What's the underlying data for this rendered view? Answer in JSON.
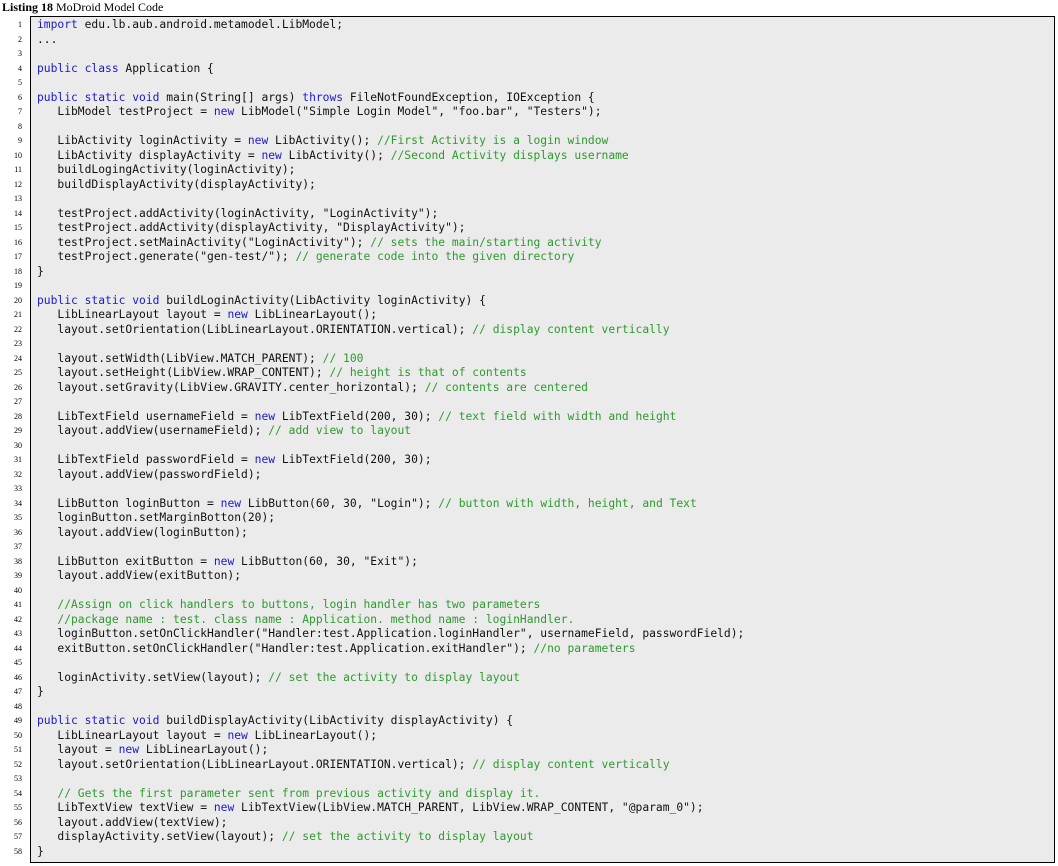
{
  "caption": {
    "label": "Listing 18",
    "title": "MoDroid Model Code"
  },
  "colors": {
    "keyword": "#1a1acc",
    "comment": "#2e9a2e",
    "text": "#111111",
    "background": "#ebebeb"
  },
  "lines": [
    {
      "n": "1",
      "tokens": [
        [
          "kw",
          "import"
        ],
        [
          "tx",
          " edu.lb.aub.android.metamodel.LibModel;"
        ]
      ]
    },
    {
      "n": "2",
      "tokens": [
        [
          "tx",
          "..."
        ]
      ]
    },
    {
      "n": "3",
      "tokens": []
    },
    {
      "n": "4",
      "tokens": [
        [
          "kw",
          "public class"
        ],
        [
          "tx",
          " Application {"
        ]
      ]
    },
    {
      "n": "5",
      "tokens": []
    },
    {
      "n": "6",
      "tokens": [
        [
          "kw",
          "public static void"
        ],
        [
          "tx",
          " main(String[] args) "
        ],
        [
          "kw",
          "throws"
        ],
        [
          "tx",
          " FileNotFoundException, IOException {"
        ]
      ]
    },
    {
      "n": "7",
      "tokens": [
        [
          "tx",
          "   LibModel testProject = "
        ],
        [
          "kw",
          "new"
        ],
        [
          "tx",
          " LibModel(\"Simple Login Model\", \"foo.bar\", \"Testers\");"
        ]
      ]
    },
    {
      "n": "8",
      "tokens": []
    },
    {
      "n": "9",
      "tokens": [
        [
          "tx",
          "   LibActivity loginActivity = "
        ],
        [
          "kw",
          "new"
        ],
        [
          "tx",
          " LibActivity(); "
        ],
        [
          "cm",
          "//First Activity is a login window"
        ]
      ]
    },
    {
      "n": "10",
      "tokens": [
        [
          "tx",
          "   LibActivity displayActivity = "
        ],
        [
          "kw",
          "new"
        ],
        [
          "tx",
          " LibActivity(); "
        ],
        [
          "cm",
          "//Second Activity displays username"
        ]
      ]
    },
    {
      "n": "11",
      "tokens": [
        [
          "tx",
          "   buildLogingActivity(loginActivity);"
        ]
      ]
    },
    {
      "n": "12",
      "tokens": [
        [
          "tx",
          "   buildDisplayActivity(displayActivity);"
        ]
      ]
    },
    {
      "n": "13",
      "tokens": []
    },
    {
      "n": "14",
      "tokens": [
        [
          "tx",
          "   testProject.addActivity(loginActivity, \"LoginActivity\");"
        ]
      ]
    },
    {
      "n": "15",
      "tokens": [
        [
          "tx",
          "   testProject.addActivity(displayActivity, \"DisplayActivity\");"
        ]
      ]
    },
    {
      "n": "16",
      "tokens": [
        [
          "tx",
          "   testProject.setMainActivity(\"LoginActivity\"); "
        ],
        [
          "cm",
          "// sets the main/starting activity"
        ]
      ]
    },
    {
      "n": "17",
      "tokens": [
        [
          "tx",
          "   testProject.generate(\"gen-test/\"); "
        ],
        [
          "cm",
          "// generate code into the given directory"
        ]
      ]
    },
    {
      "n": "18",
      "tokens": [
        [
          "tx",
          "}"
        ]
      ]
    },
    {
      "n": "19",
      "tokens": []
    },
    {
      "n": "20",
      "tokens": [
        [
          "kw",
          "public static void"
        ],
        [
          "tx",
          " buildLoginActivity(LibActivity loginActivity) {"
        ]
      ]
    },
    {
      "n": "21",
      "tokens": [
        [
          "tx",
          "   LibLinearLayout layout = "
        ],
        [
          "kw",
          "new"
        ],
        [
          "tx",
          " LibLinearLayout();"
        ]
      ]
    },
    {
      "n": "22",
      "tokens": [
        [
          "tx",
          "   layout.setOrientation(LibLinearLayout.ORIENTATION.vertical); "
        ],
        [
          "cm",
          "// display content vertically"
        ]
      ]
    },
    {
      "n": "23",
      "tokens": []
    },
    {
      "n": "24",
      "tokens": [
        [
          "tx",
          "   layout.setWidth(LibView.MATCH_PARENT); "
        ],
        [
          "cm",
          "// 100"
        ]
      ]
    },
    {
      "n": "25",
      "tokens": [
        [
          "tx",
          "   layout.setHeight(LibView.WRAP_CONTENT); "
        ],
        [
          "cm",
          "// height is that of contents"
        ]
      ]
    },
    {
      "n": "26",
      "tokens": [
        [
          "tx",
          "   layout.setGravity(LibView.GRAVITY.center_horizontal); "
        ],
        [
          "cm",
          "// contents are centered"
        ]
      ]
    },
    {
      "n": "27",
      "tokens": []
    },
    {
      "n": "28",
      "tokens": [
        [
          "tx",
          "   LibTextField usernameField = "
        ],
        [
          "kw",
          "new"
        ],
        [
          "tx",
          " LibTextField(200, 30); "
        ],
        [
          "cm",
          "// text field with width and height"
        ]
      ]
    },
    {
      "n": "29",
      "tokens": [
        [
          "tx",
          "   layout.addView(usernameField); "
        ],
        [
          "cm",
          "// add view to layout"
        ]
      ]
    },
    {
      "n": "30",
      "tokens": []
    },
    {
      "n": "31",
      "tokens": [
        [
          "tx",
          "   LibTextField passwordField = "
        ],
        [
          "kw",
          "new"
        ],
        [
          "tx",
          " LibTextField(200, 30);"
        ]
      ]
    },
    {
      "n": "32",
      "tokens": [
        [
          "tx",
          "   layout.addView(passwordField);"
        ]
      ]
    },
    {
      "n": "33",
      "tokens": []
    },
    {
      "n": "34",
      "tokens": [
        [
          "tx",
          "   LibButton loginButton = "
        ],
        [
          "kw",
          "new"
        ],
        [
          "tx",
          " LibButton(60, 30, \"Login\"); "
        ],
        [
          "cm",
          "// button with width, height, and Text"
        ]
      ]
    },
    {
      "n": "35",
      "tokens": [
        [
          "tx",
          "   loginButton.setMarginBotton(20);"
        ]
      ]
    },
    {
      "n": "36",
      "tokens": [
        [
          "tx",
          "   layout.addView(loginButton);"
        ]
      ]
    },
    {
      "n": "37",
      "tokens": []
    },
    {
      "n": "38",
      "tokens": [
        [
          "tx",
          "   LibButton exitButton = "
        ],
        [
          "kw",
          "new"
        ],
        [
          "tx",
          " LibButton(60, 30, \"Exit\");"
        ]
      ]
    },
    {
      "n": "39",
      "tokens": [
        [
          "tx",
          "   layout.addView(exitButton);"
        ]
      ]
    },
    {
      "n": "40",
      "tokens": []
    },
    {
      "n": "41",
      "tokens": [
        [
          "cm",
          "   //Assign on click handlers to buttons, login handler has two parameters"
        ]
      ]
    },
    {
      "n": "42",
      "tokens": [
        [
          "cm",
          "   //package name : test. class name : Application. method name : loginHandler."
        ]
      ]
    },
    {
      "n": "43",
      "tokens": [
        [
          "tx",
          "   loginButton.setOnClickHandler(\"Handler:test.Application.loginHandler\", usernameField, passwordField);"
        ]
      ]
    },
    {
      "n": "44",
      "tokens": [
        [
          "tx",
          "   exitButton.setOnClickHandler(\"Handler:test.Application.exitHandler\"); "
        ],
        [
          "cm",
          "//no parameters"
        ]
      ]
    },
    {
      "n": "45",
      "tokens": []
    },
    {
      "n": "46",
      "tokens": [
        [
          "tx",
          "   loginActivity.setView(layout); "
        ],
        [
          "cm",
          "// set the activity to display layout"
        ]
      ]
    },
    {
      "n": "47",
      "tokens": [
        [
          "tx",
          "}"
        ]
      ]
    },
    {
      "n": "48",
      "tokens": []
    },
    {
      "n": "49",
      "tokens": [
        [
          "kw",
          "public static void"
        ],
        [
          "tx",
          " buildDisplayActivity(LibActivity displayActivity) {"
        ]
      ]
    },
    {
      "n": "50",
      "tokens": [
        [
          "tx",
          "   LibLinearLayout layout = "
        ],
        [
          "kw",
          "new"
        ],
        [
          "tx",
          " LibLinearLayout();"
        ]
      ]
    },
    {
      "n": "51",
      "tokens": [
        [
          "tx",
          "   layout = "
        ],
        [
          "kw",
          "new"
        ],
        [
          "tx",
          " LibLinearLayout();"
        ]
      ]
    },
    {
      "n": "52",
      "tokens": [
        [
          "tx",
          "   layout.setOrientation(LibLinearLayout.ORIENTATION.vertical); "
        ],
        [
          "cm",
          "// display content vertically"
        ]
      ]
    },
    {
      "n": "53",
      "tokens": []
    },
    {
      "n": "54",
      "tokens": [
        [
          "cm",
          "   // Gets the first parameter sent from previous activity and display it."
        ]
      ]
    },
    {
      "n": "55",
      "tokens": [
        [
          "tx",
          "   LibTextView textView = "
        ],
        [
          "kw",
          "new"
        ],
        [
          "tx",
          " LibTextView(LibView.MATCH_PARENT, LibView.WRAP_CONTENT, \"@param_0\");"
        ]
      ]
    },
    {
      "n": "56",
      "tokens": [
        [
          "tx",
          "   layout.addView(textView);"
        ]
      ]
    },
    {
      "n": "57",
      "tokens": [
        [
          "tx",
          "   displayActivity.setView(layout); "
        ],
        [
          "cm",
          "// set the activity to display layout"
        ]
      ]
    },
    {
      "n": "58",
      "tokens": [
        [
          "tx",
          "}"
        ]
      ]
    }
  ]
}
